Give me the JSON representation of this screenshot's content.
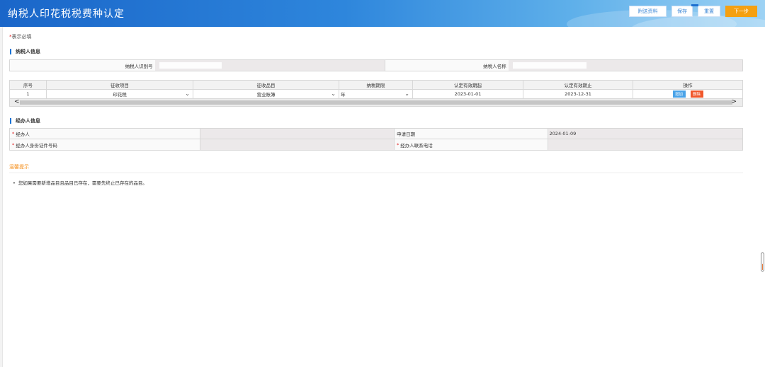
{
  "header": {
    "title": "纳税人印花税税费种认定",
    "buttons": {
      "attach": "附送资料",
      "save": "保存",
      "reset": "重置",
      "next": "下一步"
    }
  },
  "required_note": {
    "star": "*",
    "text": "表示必填"
  },
  "taxpayer_section": {
    "title": "纳税人信息",
    "id_label": "纳税人识别号",
    "name_label": "纳税人名称"
  },
  "levy_table": {
    "columns": [
      "序号",
      "征收项目",
      "征收品目",
      "纳税期限",
      "认定有效期起",
      "认定有效期止",
      "操作"
    ],
    "rows": [
      {
        "index": "1",
        "item": "印花税",
        "sub_item": "营业账簿",
        "period": "年",
        "start": "2023-01-01",
        "end": "2023-12-31",
        "add": "增加",
        "delete": "删除"
      }
    ],
    "scroll_left": "<",
    "scroll_right": ">"
  },
  "handler_section": {
    "title": "经办人信息",
    "handler_label": "经办人",
    "apply_date_label": "申请日期",
    "apply_date_value": "2024-01-09",
    "id_no_label": "经办人身份证件号码",
    "phone_label": "经办人联系电话",
    "star": "*"
  },
  "tips": {
    "title": "温馨提示",
    "items": [
      "您如果需要新增品目且品目已存在，需要先终止已存在的品目。"
    ]
  },
  "colors": {
    "header_start": "#1a66c9",
    "next_button": "#f5a011",
    "add_button": "#4aa3e8",
    "delete_button": "#f0582c",
    "tips_title": "#f5901e"
  }
}
